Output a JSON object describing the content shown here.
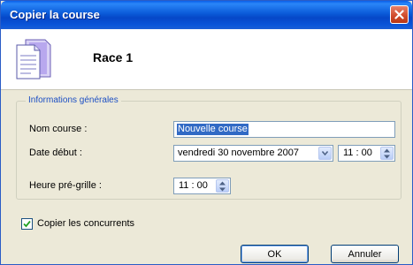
{
  "window": {
    "title": "Copier la course"
  },
  "header": {
    "race_name": "Race 1"
  },
  "group": {
    "legend": "Informations générales",
    "name_label": "Nom course :",
    "name_value": "Nouvelle course",
    "date_label": "Date début :",
    "date_value": "vendredi 30 novembre 2007",
    "start_time_value": "11 : 00",
    "pregrid_label": "Heure pré-grille :",
    "pregrid_time_value": "11 : 00"
  },
  "options": {
    "copy_competitors_label": "Copier les concurrents",
    "copy_competitors_checked": true
  },
  "buttons": {
    "ok": "OK",
    "cancel": "Annuler"
  },
  "colors": {
    "titlebar": "#0a55d9",
    "legend_text": "#1c4fc4",
    "selection": "#316ac5",
    "dialog_bg": "#ece9d8"
  }
}
